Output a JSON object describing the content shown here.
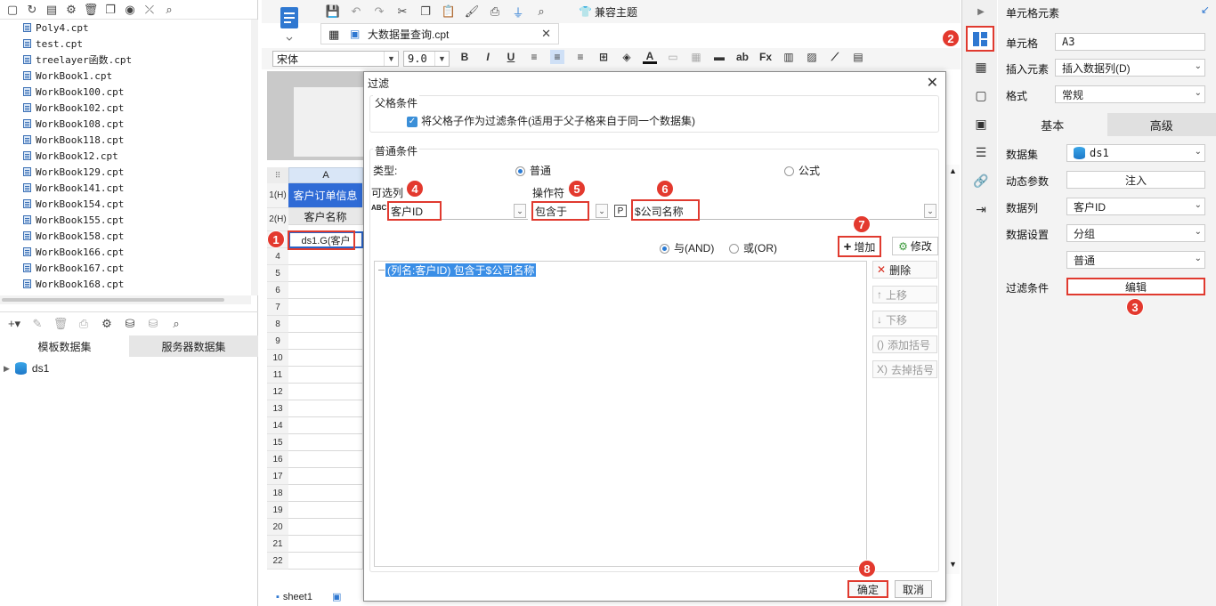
{
  "left_panel": {
    "files": [
      "Poly4.cpt",
      "test.cpt",
      "treelayer函数.cpt",
      "WorkBook1.cpt",
      "WorkBook100.cpt",
      "WorkBook102.cpt",
      "WorkBook108.cpt",
      "WorkBook118.cpt",
      "WorkBook12.cpt",
      "WorkBook129.cpt",
      "WorkBook141.cpt",
      "WorkBook154.cpt",
      "WorkBook155.cpt",
      "WorkBook158.cpt",
      "WorkBook166.cpt",
      "WorkBook167.cpt",
      "WorkBook168.cpt"
    ],
    "tabs": [
      "模板数据集",
      "服务器数据集"
    ],
    "dataset": "ds1"
  },
  "toolbar": {
    "theme_label": "兼容主题"
  },
  "tab": {
    "title": "大数据量查询.cpt"
  },
  "format": {
    "font": "宋体",
    "size": "9.0"
  },
  "grid": {
    "col": "A",
    "rows": [
      "1(H)",
      "2(H)",
      "3",
      "4",
      "5",
      "6",
      "7",
      "8",
      "9",
      "10",
      "11",
      "12",
      "13",
      "14",
      "15",
      "16",
      "17",
      "18",
      "19",
      "20",
      "21",
      "22"
    ],
    "cell_a1": "客户订单信息",
    "cell_a2": "客户名称",
    "cell_a3": "ds1.G(客户",
    "sheet": "sheet1"
  },
  "dialog": {
    "title": "过滤",
    "parent_group": "父格条件",
    "parent_check": "将父格子作为过滤条件(适用于父子格来自于同一个数据集)",
    "normal_group": "普通条件",
    "type_label": "类型:",
    "type_normal": "普通",
    "type_formula": "公式",
    "col_label": "可选列",
    "col_value": "客户ID",
    "op_label": "操作符",
    "op_value": "包含于",
    "param_value": "$公司名称",
    "and_label": "与(AND)",
    "or_label": "或(OR)",
    "add_label": "增加",
    "modify_label": "修改",
    "condition": "(列名:客户ID) 包含于$公司名称",
    "side_buttons": [
      "删除",
      "上移",
      "下移",
      "添加括号",
      "去掉括号"
    ],
    "ok": "确定",
    "cancel": "取消"
  },
  "right_panel": {
    "title": "单元格元素",
    "cell_label": "单元格",
    "cell_value": "A3",
    "insert_label": "插入元素",
    "insert_value": "插入数据列(D)",
    "format_label": "格式",
    "format_value": "常规",
    "tabs": [
      "基本",
      "高级"
    ],
    "dataset_label": "数据集",
    "dataset_value": "ds1",
    "param_label": "动态参数",
    "param_value": "注入",
    "column_label": "数据列",
    "column_value": "客户ID",
    "setting_label": "数据设置",
    "setting_value": "分组",
    "setting_value2": "普通",
    "filter_label": "过滤条件",
    "filter_value": "编辑"
  },
  "badges": [
    "1",
    "2",
    "3",
    "4",
    "5",
    "6",
    "7",
    "8"
  ],
  "colors": {
    "accent": "#3a8ee6",
    "highlight_red": "#e03a2f",
    "header_blue": "#2f6bd6"
  }
}
